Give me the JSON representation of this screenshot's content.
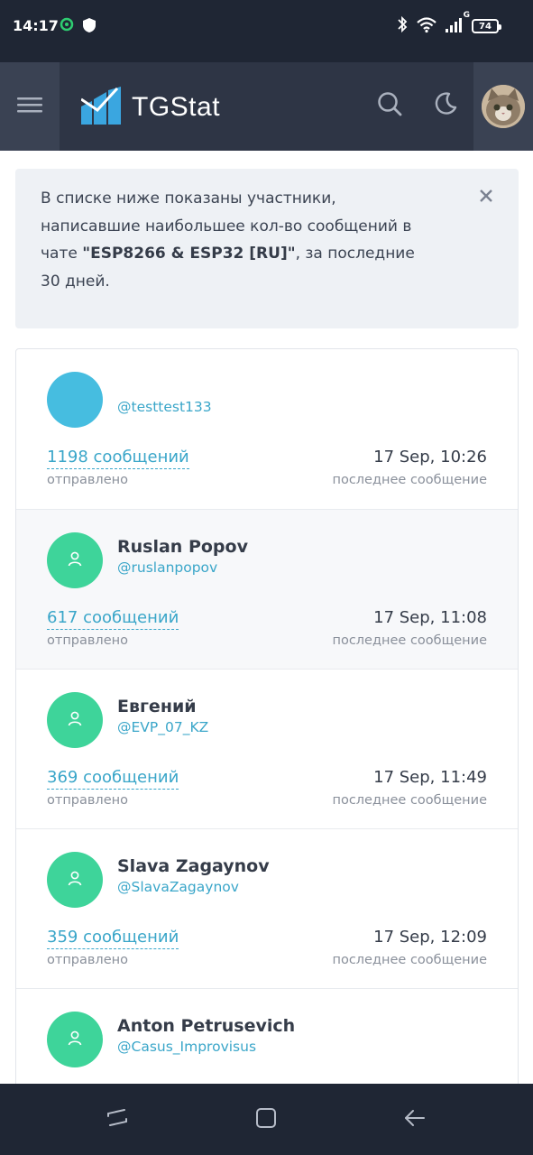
{
  "status_bar": {
    "time": "14:17",
    "left_icons": [
      "sync-icon",
      "shield-icon"
    ],
    "right_icons": [
      "bluetooth-icon",
      "wifi-icon",
      "signal-icon"
    ],
    "network": "G",
    "battery": "74"
  },
  "header": {
    "brand": "TGStat",
    "icons": [
      "menu-icon",
      "logo-icon",
      "search-icon",
      "moon-icon",
      "avatar"
    ]
  },
  "alert": {
    "text_before": "В списке ниже показаны участники, написавшие наибольшее кол-во сообщений в чате ",
    "chat_name": "\"ESP8266 & ESP32 [RU]\"",
    "text_after": ", за последние 30 дней.",
    "close": "×"
  },
  "colors": {
    "accent": "#3aa6c9",
    "avatar_default": "#3ed49a",
    "avatar_first": "#46bde0",
    "header_bg": "#2e3545"
  },
  "list": {
    "sent_label": "отправлено",
    "last_label": "последнее сообщение",
    "items": [
      {
        "name": "",
        "handle": "@testtest133",
        "count": "1198 сообщений",
        "date": "17 Sep, 10:26"
      },
      {
        "name": "Ruslan Popov",
        "handle": "@ruslanpopov",
        "count": "617 сообщений",
        "date": "17 Sep, 11:08"
      },
      {
        "name": "Евгений",
        "handle": "@EVP_07_KZ",
        "count": "369 сообщений",
        "date": "17 Sep, 11:49"
      },
      {
        "name": "Slava Zagaynov",
        "handle": "@SlavaZagaynov",
        "count": "359 сообщений",
        "date": "17 Sep, 12:09"
      },
      {
        "name": "Anton Petrusevich",
        "handle": "@Casus_Improvisus",
        "count": "",
        "date": ""
      }
    ]
  },
  "nav": {
    "icons": [
      "recent-apps-icon",
      "home-icon",
      "back-icon"
    ]
  }
}
